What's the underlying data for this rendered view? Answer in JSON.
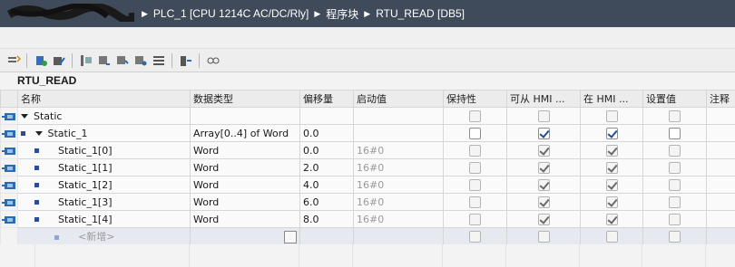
{
  "breadcrumb": {
    "items": [
      "PLC_1 [CPU 1214C AC/DC/Rly]",
      "程序块",
      "RTU_READ [DB5]"
    ]
  },
  "block": {
    "name": "RTU_READ"
  },
  "table": {
    "columns": [
      "名称",
      "数据类型",
      "偏移量",
      "启动值",
      "保持性",
      "可从 HMI ...",
      "在 HMI ...",
      "设置值",
      "注释"
    ],
    "rows": [
      {
        "name": "Static",
        "type": "",
        "offset": "",
        "start": "",
        "retain": false,
        "hmi_access": false,
        "hmi_visible": false,
        "setpoint": false
      },
      {
        "name": "Static_1",
        "type": "Array[0..4] of Word",
        "offset": "0.0",
        "start": "",
        "retain": false,
        "hmi_access": true,
        "hmi_visible": true,
        "setpoint": false
      },
      {
        "name": "Static_1[0]",
        "type": "Word",
        "offset": "0.0",
        "start": "16#0",
        "retain": false,
        "hmi_access": true,
        "hmi_visible": true,
        "setpoint": false
      },
      {
        "name": "Static_1[1]",
        "type": "Word",
        "offset": "2.0",
        "start": "16#0",
        "retain": false,
        "hmi_access": true,
        "hmi_visible": true,
        "setpoint": false
      },
      {
        "name": "Static_1[2]",
        "type": "Word",
        "offset": "4.0",
        "start": "16#0",
        "retain": false,
        "hmi_access": true,
        "hmi_visible": true,
        "setpoint": false
      },
      {
        "name": "Static_1[3]",
        "type": "Word",
        "offset": "6.0",
        "start": "16#0",
        "retain": false,
        "hmi_access": true,
        "hmi_visible": true,
        "setpoint": false
      },
      {
        "name": "Static_1[4]",
        "type": "Word",
        "offset": "8.0",
        "start": "16#0",
        "retain": false,
        "hmi_access": true,
        "hmi_visible": true,
        "setpoint": false
      }
    ],
    "new_row": "<新增>"
  },
  "colors": {
    "titlebar": "#3f4a5a",
    "checkbox_check": "#1f4f8f",
    "icon_blue": "#2b6cb0"
  }
}
